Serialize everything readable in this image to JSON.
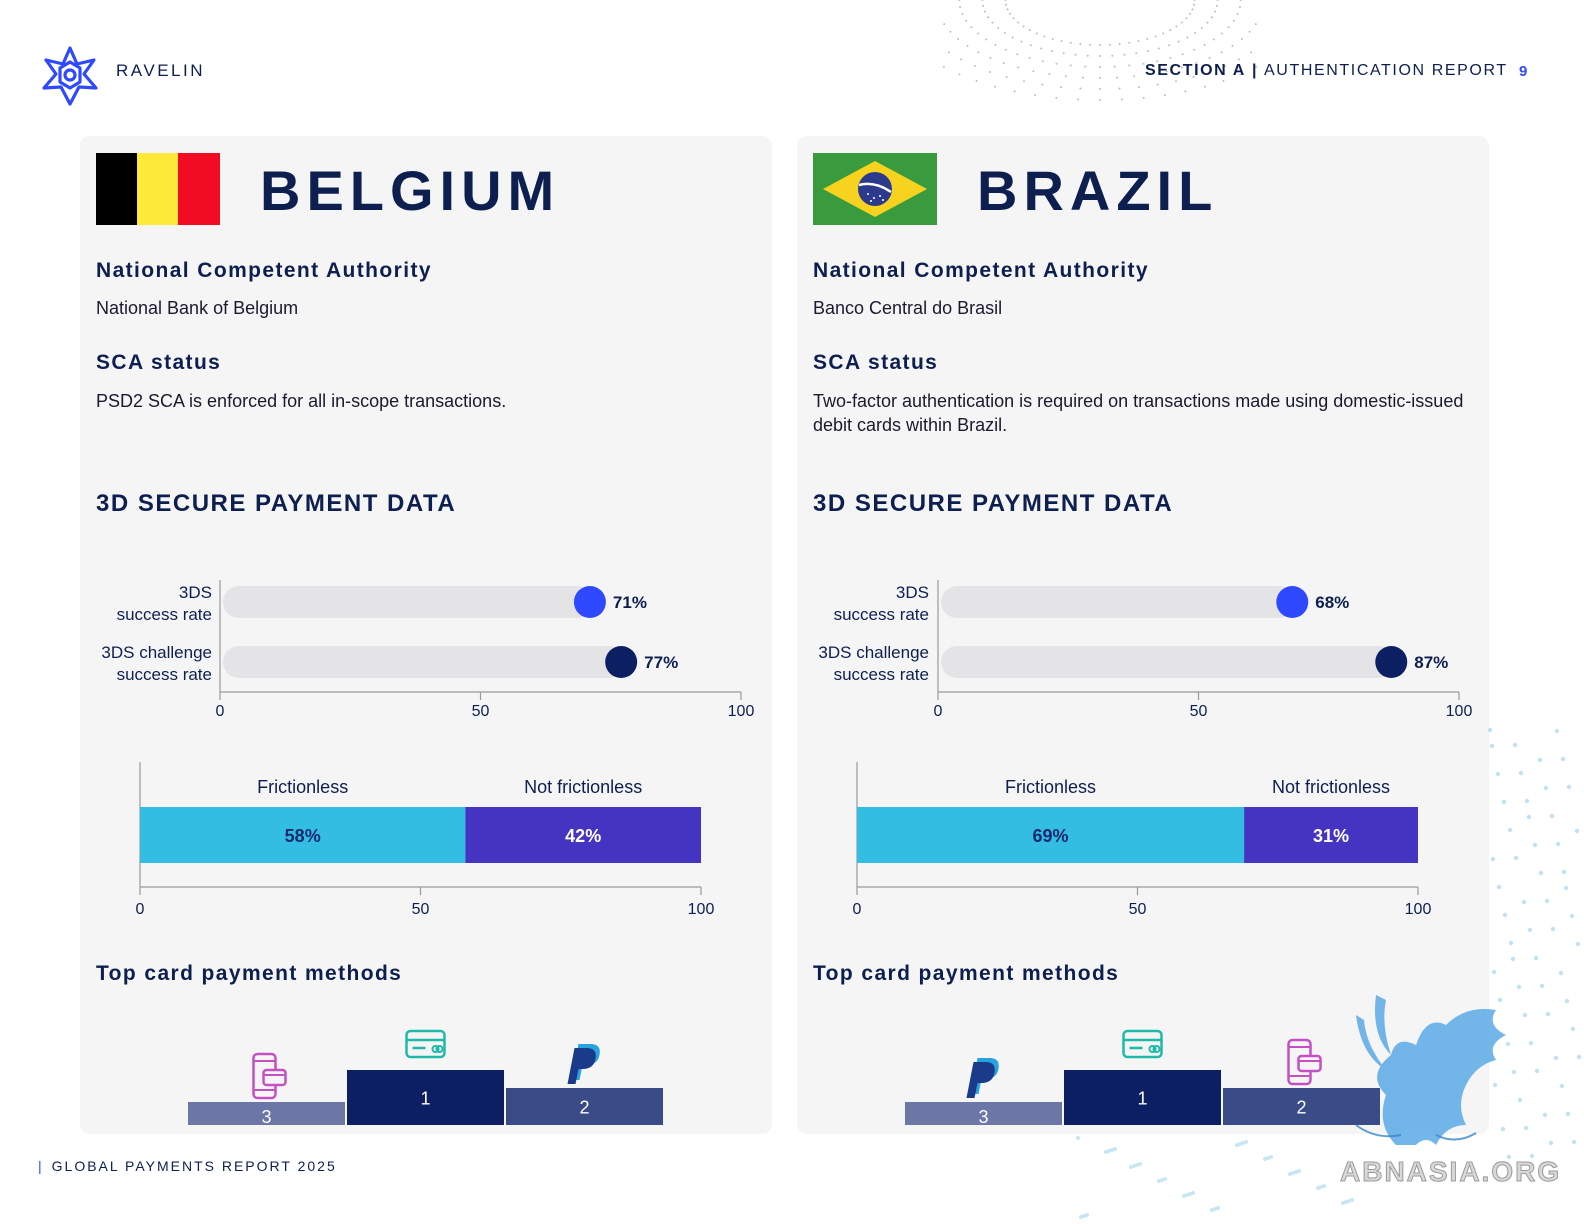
{
  "header": {
    "brand": "RAVELIN",
    "section": "SECTION A",
    "separator": "|",
    "report": "AUTHENTICATION REPORT",
    "page_number": "9"
  },
  "footer": {
    "bar": "|",
    "text": "GLOBAL PAYMENTS REPORT 2025"
  },
  "watermark": "ABNASIA.ORG",
  "colors": {
    "navy": "#0d1f4f",
    "blue_dot": "#2e49ff",
    "frictionless": "#33bde3",
    "not_frictionless": "#4533c1",
    "podium_1": "#0c1f63",
    "podium_2": "#394c88",
    "podium_3": "#6c77a6",
    "track": "#e4e4e6"
  },
  "countries": [
    {
      "name": "BELGIUM",
      "flag": "belgium-flag",
      "nca_heading": "National Competent Authority",
      "nca": "National Bank of Belgium",
      "sca_heading": "SCA status",
      "sca": "PSD2 SCA is enforced for all in-scope transactions.",
      "section_heading": "3D SECURE PAYMENT DATA",
      "top_methods_heading": "Top card payment methods",
      "podium": [
        {
          "rank": "3",
          "icon": "mobile-wallet-icon"
        },
        {
          "rank": "1",
          "icon": "credit-card-icon"
        },
        {
          "rank": "2",
          "icon": "paypal-icon"
        }
      ]
    },
    {
      "name": "BRAZIL",
      "flag": "brazil-flag",
      "nca_heading": "National Competent Authority",
      "nca": "Banco Central do Brasil",
      "sca_heading": "SCA status",
      "sca": "Two-factor authentication is required on transactions made using domestic-issued debit cards within Brazil.",
      "section_heading": "3D SECURE PAYMENT DATA",
      "top_methods_heading": "Top card payment methods",
      "podium": [
        {
          "rank": "3",
          "icon": "paypal-icon"
        },
        {
          "rank": "1",
          "icon": "credit-card-icon"
        },
        {
          "rank": "2",
          "icon": "mobile-wallet-icon"
        }
      ]
    }
  ],
  "chart_data": [
    {
      "type": "bar",
      "orientation": "horizontal",
      "categories": [
        [
          "3DS",
          "success rate"
        ],
        [
          "3DS challenge",
          "success rate"
        ]
      ],
      "values": [
        71,
        77
      ],
      "value_labels": [
        "71%",
        "77%"
      ],
      "marker_colors": [
        "#2e49ff",
        "#0c1f63"
      ],
      "xlim": [
        0,
        100
      ],
      "xticks": [
        "0",
        "50",
        "100"
      ]
    },
    {
      "type": "bar",
      "orientation": "horizontal-stacked",
      "series": [
        {
          "name": "Frictionless",
          "values": [
            58
          ],
          "label": "58%",
          "color": "#33bde3"
        },
        {
          "name": "Not frictionless",
          "values": [
            42
          ],
          "label": "42%",
          "color": "#4533c1"
        }
      ],
      "xlim": [
        0,
        100
      ],
      "xticks": [
        "0",
        "50",
        "100"
      ]
    },
    {
      "type": "bar",
      "orientation": "horizontal",
      "categories": [
        [
          "3DS",
          "success rate"
        ],
        [
          "3DS challenge",
          "success rate"
        ]
      ],
      "values": [
        68,
        87
      ],
      "value_labels": [
        "68%",
        "87%"
      ],
      "marker_colors": [
        "#2e49ff",
        "#0c1f63"
      ],
      "xlim": [
        0,
        100
      ],
      "xticks": [
        "0",
        "50",
        "100"
      ]
    },
    {
      "type": "bar",
      "orientation": "horizontal-stacked",
      "series": [
        {
          "name": "Frictionless",
          "values": [
            69
          ],
          "label": "69%",
          "color": "#33bde3"
        },
        {
          "name": "Not frictionless",
          "values": [
            31
          ],
          "label": "31%",
          "color": "#4533c1"
        }
      ],
      "xlim": [
        0,
        100
      ],
      "xticks": [
        "0",
        "50",
        "100"
      ]
    }
  ]
}
